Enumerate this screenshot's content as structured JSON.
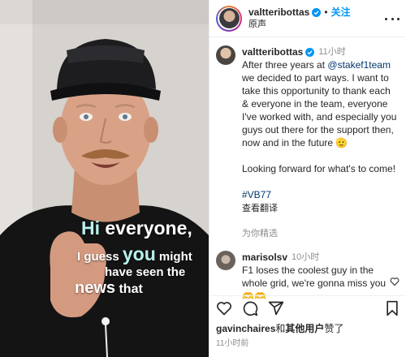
{
  "header": {
    "username": "valtteribottas",
    "separator": "•",
    "follow_label": "关注",
    "audio_label": "原声"
  },
  "caption": {
    "username": "valtteribottas",
    "time": "11小时",
    "text_before_mention": "After three years at ",
    "mention": "@stakef1team",
    "text_after_mention": " we decided to part ways. I want to take this opportunity to thank each & everyone in the team, everyone I've worked with, and especially you guys out there for the support then, now and in the future 🫡\n\nLooking forward for what's to come!\n\n",
    "hashtag": "#VB77",
    "see_translation": "查看翻译"
  },
  "featured_label": "为你精选",
  "comment": {
    "username": "marisolsv",
    "time": "10小时",
    "text": "F1 loses the coolest guy in the whole grid, we're gonna miss you 🫶🫶"
  },
  "likes": {
    "user": "gavinchaires",
    "joiner": "和",
    "others": "其他用户",
    "suffix": "赞了"
  },
  "posted_time": "11小时前",
  "video_captions": {
    "line1_hl": "Hi",
    "line1_rest": " everyone,",
    "line2_pre": "I guess ",
    "line2_big": "you",
    "line2_post": " might",
    "line2b": "have seen the",
    "line3_big": "news",
    "line3_post": " that"
  },
  "colors": {
    "accent_blue": "#0095f6",
    "link_blue": "#00376b",
    "muted": "#8e8e8e",
    "caption_highlight": "#b7f2ee"
  },
  "icons": [
    "verified-badge-icon",
    "more-icon",
    "heart-icon",
    "comment-icon",
    "share-icon",
    "save-icon"
  ]
}
